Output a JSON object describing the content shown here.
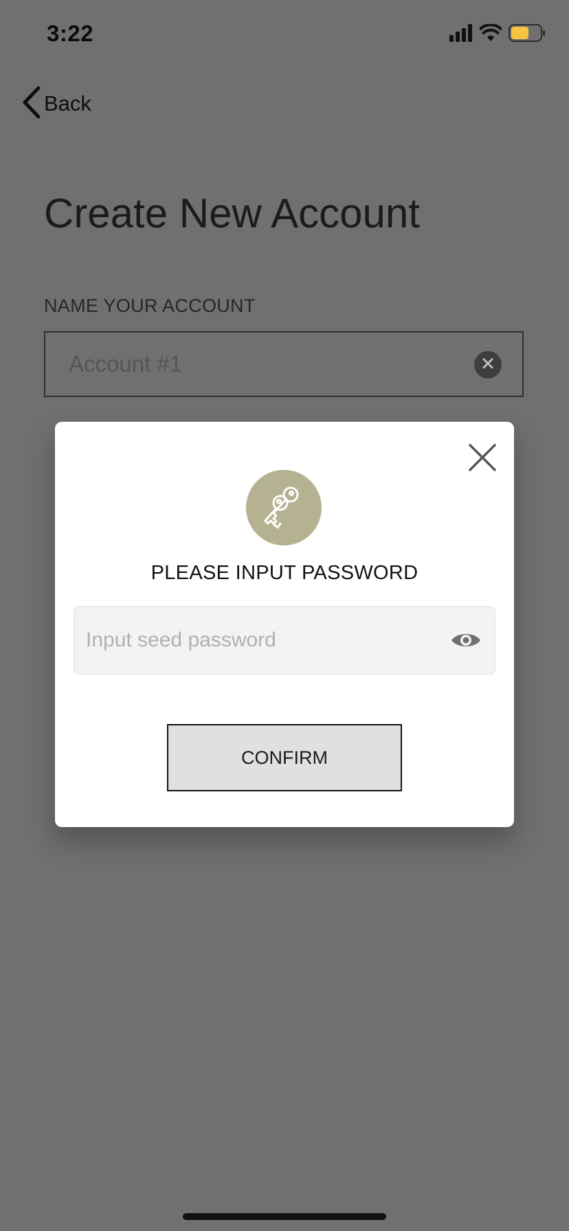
{
  "status_bar": {
    "time": "3:22",
    "battery_color": "#f5c542"
  },
  "nav": {
    "back_label": "Back"
  },
  "page": {
    "title": "Create New Account",
    "field_label": "NAME YOUR ACCOUNT",
    "account_placeholder": "Account #1"
  },
  "modal": {
    "heading": "PLEASE INPUT PASSWORD",
    "password_placeholder": "Input seed password",
    "confirm_label": "CONFIRM",
    "icon_badge_color": "#b5b291"
  },
  "icons": {
    "signal": "cellular-signal-icon",
    "wifi": "wifi-icon",
    "battery": "battery-icon",
    "back": "chevron-left-icon",
    "clear": "clear-circle-icon",
    "close": "close-icon",
    "keys": "keys-icon",
    "eye": "eye-icon"
  }
}
